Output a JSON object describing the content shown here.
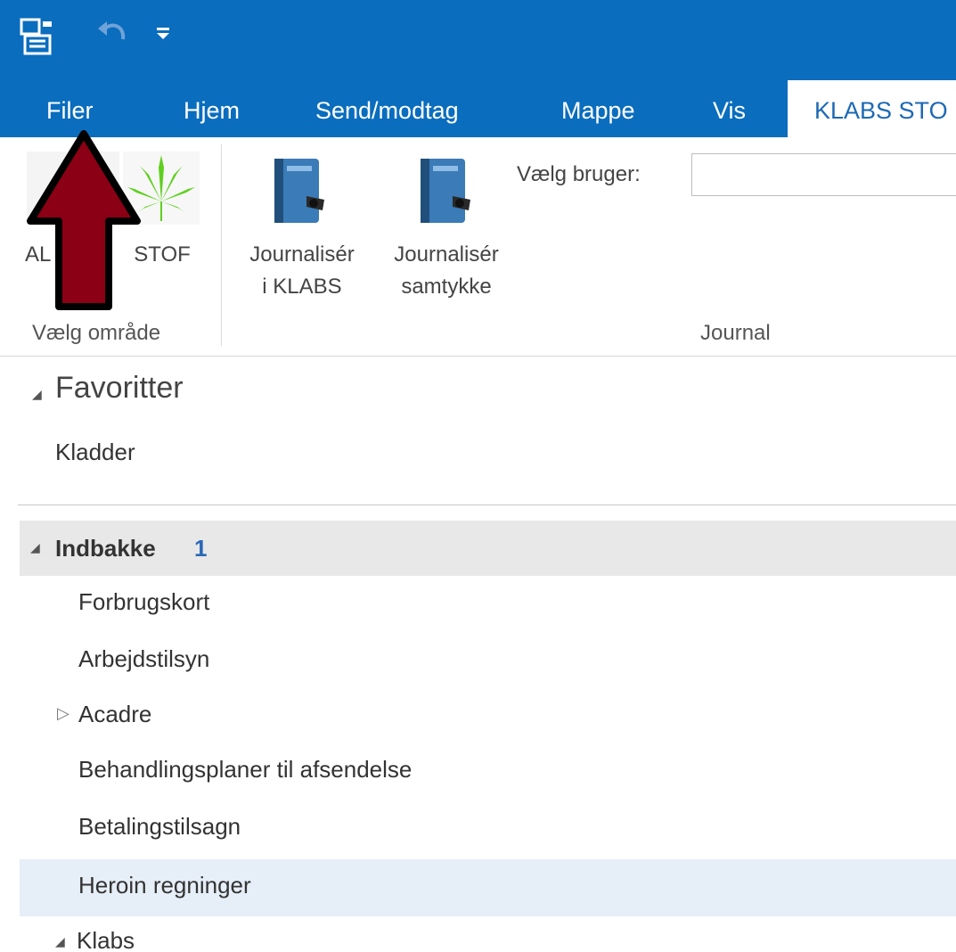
{
  "qat": {
    "icons": [
      "outlook-app-icon",
      "undo-icon",
      "customize-qat-icon"
    ]
  },
  "tabs": [
    {
      "label": "Filer"
    },
    {
      "label": "Hjem"
    },
    {
      "label": "Send/modtag"
    },
    {
      "label": "Mappe"
    },
    {
      "label": "Vis"
    },
    {
      "label": "KLABS STO"
    }
  ],
  "ribbon": {
    "area_group": {
      "label": "Vælg område",
      "buttons": [
        {
          "label": "AL"
        },
        {
          "label": "STOF"
        }
      ]
    },
    "journal_group": {
      "label": "Journal",
      "buttons": [
        {
          "line1": "Journalisér",
          "line2": "i KLABS"
        },
        {
          "line1": "Journalisér",
          "line2": "samtykke"
        }
      ],
      "select_user_label": "Vælg bruger:",
      "select_user_value": ""
    }
  },
  "folder_pane": {
    "favorites_header": "Favoritter",
    "favorites": [
      "Kladder"
    ],
    "inbox": {
      "label": "Indbakke",
      "count": "1"
    },
    "subfolders": [
      {
        "label": "Forbrugskort"
      },
      {
        "label": "Arbejdstilsyn"
      },
      {
        "label": "Acadre"
      },
      {
        "label": "Behandlingsplaner til afsendelse"
      },
      {
        "label": "Betalingstilsagn"
      },
      {
        "label": "Heroin regninger"
      }
    ],
    "last": {
      "label": "Klabs"
    }
  },
  "colors": {
    "title_bar": "#0a6dbe",
    "tab_active_text": "#1d69b3",
    "arrow_fill": "#8b0015",
    "arrow_outline": "#000000",
    "count": "#2a68b6"
  }
}
